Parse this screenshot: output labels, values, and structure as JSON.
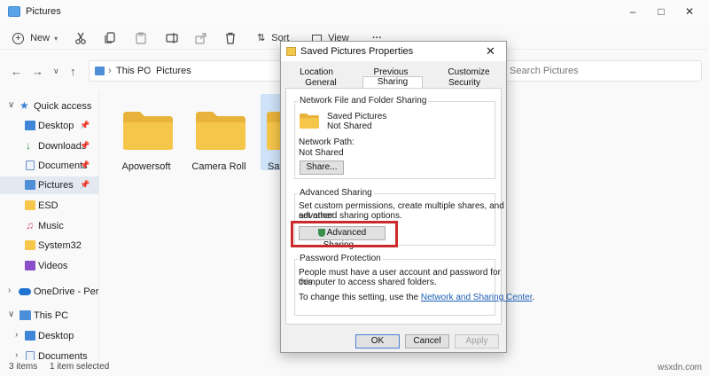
{
  "explorer": {
    "title": "Pictures",
    "toolbar": {
      "new_label": "New",
      "sort_label": "Sort",
      "view_label": "View",
      "more_label": "···"
    },
    "address": {
      "crumbs": [
        "This PC",
        "Pictures"
      ],
      "search_placeholder": "Search Pictures"
    },
    "sidebar": {
      "items": [
        {
          "label": "Quick access"
        },
        {
          "label": "Desktop"
        },
        {
          "label": "Downloads"
        },
        {
          "label": "Documents"
        },
        {
          "label": "Pictures"
        },
        {
          "label": "ESD"
        },
        {
          "label": "Music"
        },
        {
          "label": "System32"
        },
        {
          "label": "Videos"
        },
        {
          "label": "OneDrive - Perso"
        },
        {
          "label": "This PC"
        },
        {
          "label": "Desktop"
        },
        {
          "label": "Documents"
        }
      ]
    },
    "folders": [
      {
        "name": "Apowersoft"
      },
      {
        "name": "Camera Roll"
      },
      {
        "name": "Save"
      }
    ],
    "status": {
      "items": "3 items",
      "selected": "1 item selected"
    }
  },
  "dialog": {
    "title": "Saved Pictures Properties",
    "tabs_back": [
      "Location",
      "Previous Versions",
      "Customize"
    ],
    "tabs_front": [
      "General",
      "Sharing",
      "Security"
    ],
    "active_tab": "Sharing",
    "network_sharing": {
      "heading": "Network File and Folder Sharing",
      "folder_name": "Saved Pictures",
      "folder_state": "Not Shared",
      "path_label": "Network Path:",
      "path_value": "Not Shared",
      "share_button": "Share..."
    },
    "advanced_sharing": {
      "heading": "Advanced Sharing",
      "description_1": "Set custom permissions, create multiple shares, and set other",
      "description_2": "advanced sharing options.",
      "button": "Advanced Sharing..."
    },
    "password_protection": {
      "heading": "Password Protection",
      "description_1": "People must have a user account and password for this",
      "description_2": "computer to access shared folders.",
      "change_prefix": "To change this setting, use the",
      "link": "Network and Sharing Center",
      "change_suffix": "."
    },
    "buttons": {
      "ok": "OK",
      "cancel": "Cancel",
      "apply": "Apply"
    }
  },
  "watermark": "wsxdn.com",
  "colors": {
    "folder_yellow": "#f6c64a",
    "highlight_red": "#cc2a2a",
    "link_blue": "#1a5fb4",
    "selected_nav": "#e3e8f1"
  }
}
